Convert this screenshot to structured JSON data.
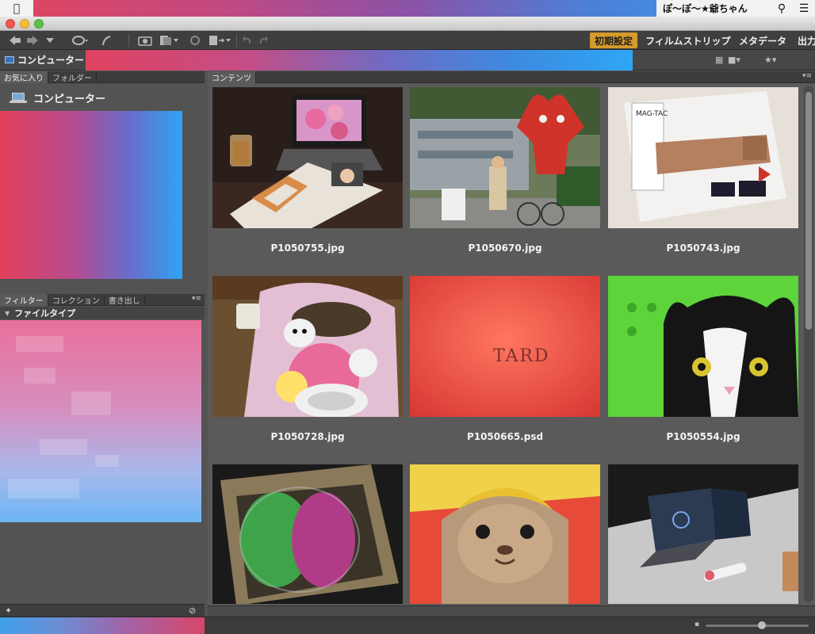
{
  "menubar": {
    "user_name": "ぽ〜ぽ〜★爺ちゃん",
    "apple_icon": "apple-icon",
    "search_icon": "search-icon",
    "list_icon": "list-icon"
  },
  "toolbar": {
    "workspaces": [
      {
        "label": "初期設定",
        "active": true
      },
      {
        "label": "フィルムストリップ",
        "active": false
      },
      {
        "label": "メタデータ",
        "active": false
      },
      {
        "label": "出力",
        "active": false
      }
    ]
  },
  "pathbar": {
    "location": "コンピューター"
  },
  "favorites_panel": {
    "tabs": [
      "お気に入り",
      "フォルダー"
    ],
    "items": [
      {
        "label": "コンピューター",
        "icon": "laptop-icon"
      }
    ]
  },
  "filter_panel": {
    "tabs": [
      "フィルター",
      "コレクション",
      "書き出し"
    ],
    "section_header": "ファイルタイプ"
  },
  "content_panel": {
    "tab": "コンテンツ",
    "thumbnails": [
      {
        "filename": "P1050755.jpg"
      },
      {
        "filename": "P1050670.jpg"
      },
      {
        "filename": "P1050743.jpg"
      },
      {
        "filename": "P1050728.jpg"
      },
      {
        "filename": "P1050665.psd"
      },
      {
        "filename": "P1050554.jpg"
      },
      {
        "filename": ""
      },
      {
        "filename": ""
      },
      {
        "filename": ""
      }
    ],
    "photo_texts": {
      "stone_text": "TARD",
      "brand_text": "MAG-TAC"
    }
  },
  "colors": {
    "accent": "#d49b2b",
    "panel_bg": "#535353",
    "toolbar_bg": "#3f3f3f"
  }
}
